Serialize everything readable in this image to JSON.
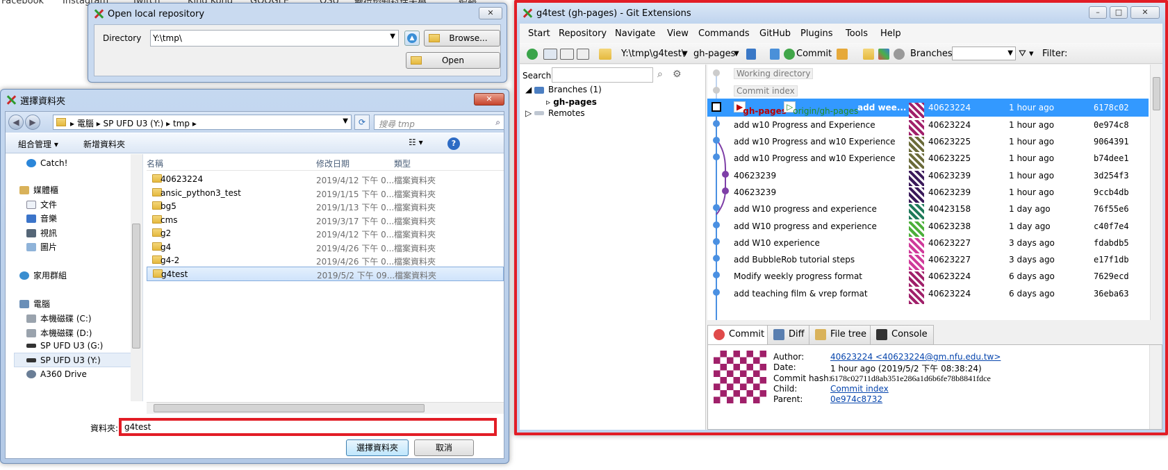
{
  "background": {
    "bookmarks": [
      "Facebook",
      "Instagram",
      "Twitch",
      "King Kong",
      "GOOGLE",
      "OSU",
      "數位控制科技大學",
      "編輯"
    ]
  },
  "open_repo": {
    "title": "Open local repository",
    "directory_label": "Directory",
    "directory_value": "Y:\\tmp\\",
    "browse_label": "Browse...",
    "open_label": "Open"
  },
  "folder_dialog": {
    "title": "選擇資料夾",
    "breadcrumb": [
      "電腦",
      "SP UFD U3 (Y:)",
      "tmp"
    ],
    "search_placeholder": "搜尋 tmp",
    "organize_label": "組合管理 ▾",
    "new_folder_label": "新增資料夾",
    "tree": [
      {
        "label": "Catch!",
        "icon": "catch-icon"
      },
      {
        "label": "媒體櫃",
        "icon": "library-icon"
      },
      {
        "label": "文件",
        "icon": "document-icon"
      },
      {
        "label": "音樂",
        "icon": "music-icon"
      },
      {
        "label": "視訊",
        "icon": "video-icon"
      },
      {
        "label": "圖片",
        "icon": "picture-icon"
      },
      {
        "label": "家用群組",
        "icon": "homegroup-icon"
      },
      {
        "label": "電腦",
        "icon": "computer-icon"
      },
      {
        "label": "本機磁碟 (C:)",
        "icon": "drive-icon"
      },
      {
        "label": "本機磁碟 (D:)",
        "icon": "drive-icon"
      },
      {
        "label": "SP UFD U3 (G:)",
        "icon": "usb-drive-icon"
      },
      {
        "label": "SP UFD U3 (Y:)",
        "icon": "usb-drive-icon"
      },
      {
        "label": "A360 Drive",
        "icon": "cloud-drive-icon"
      }
    ],
    "columns": [
      "名稱",
      "修改日期",
      "類型"
    ],
    "files": [
      {
        "name": "40623224",
        "date": "2019/4/12 下午 0...",
        "type": "檔案資料夾"
      },
      {
        "name": "ansic_python3_test",
        "date": "2019/1/15 下午 0...",
        "type": "檔案資料夾"
      },
      {
        "name": "bg5",
        "date": "2019/1/13 下午 0...",
        "type": "檔案資料夾"
      },
      {
        "name": "cms",
        "date": "2019/3/17 下午 0...",
        "type": "檔案資料夾"
      },
      {
        "name": "g2",
        "date": "2019/4/12 下午 0...",
        "type": "檔案資料夾"
      },
      {
        "name": "g4",
        "date": "2019/4/26 下午 0...",
        "type": "檔案資料夾"
      },
      {
        "name": "g4-2",
        "date": "2019/4/26 下午 0...",
        "type": "檔案資料夾"
      },
      {
        "name": "g4test",
        "date": "2019/5/2 下午 09...",
        "type": "檔案資料夾"
      }
    ],
    "folder_label": "資料夾:",
    "folder_value": "g4test",
    "select_label": "選擇資料夾",
    "cancel_label": "取消"
  },
  "git": {
    "title": "g4test (gh-pages) - Git Extensions",
    "menu": [
      "Start",
      "Repository",
      "Navigate",
      "View",
      "Commands",
      "GitHub",
      "Plugins",
      "Tools",
      "Help"
    ],
    "toolbar": {
      "path": "Y:\\tmp\\g4test\\",
      "branch": "gh-pages",
      "commit_label": "Commit",
      "branches_label": "Branches:",
      "filter_label": "Filter:"
    },
    "search_label": "Search:",
    "tree": {
      "branches": "Branches (1)",
      "current_branch": "gh-pages",
      "remotes": "Remotes"
    },
    "working_directory": "Working directory",
    "commit_index": "Commit index",
    "commits": [
      {
        "branch_tag": "gh-pages",
        "remote_tag": "origin/gh-pages",
        "message": "add wee...",
        "author": "40623224",
        "date": "1 hour ago",
        "hash": "6178c02",
        "selected": true
      },
      {
        "message": "add w10 Progress and Experience",
        "author": "40623224",
        "date": "1 hour ago",
        "hash": "0e974c8"
      },
      {
        "message": "add w10 Progress and w10 Experience",
        "author": "40623225",
        "date": "1 hour ago",
        "hash": "9064391"
      },
      {
        "message": "add w10 Progress and w10 Experience",
        "author": "40623225",
        "date": "1 hour ago",
        "hash": "b74dee1"
      },
      {
        "message": "40623239",
        "author": "40623239",
        "date": "1 hour ago",
        "hash": "3d254f3"
      },
      {
        "message": "40623239",
        "author": "40623239",
        "date": "1 hour ago",
        "hash": "9ccb4db"
      },
      {
        "message": "add W10 progress and experience",
        "author": "40423158",
        "date": "1 day ago",
        "hash": "76f55e6"
      },
      {
        "message": "add W10 progress and experience",
        "author": "40623238",
        "date": "1 day ago",
        "hash": "c40f7e4"
      },
      {
        "message": "add W10 experience",
        "author": "40623227",
        "date": "3 days ago",
        "hash": "fdabdb5"
      },
      {
        "message": "add BubbleRob tutorial steps",
        "author": "40623227",
        "date": "3 days ago",
        "hash": "e17f1db"
      },
      {
        "message": "Modify weekly progress format",
        "author": "40623224",
        "date": "6 days ago",
        "hash": "7629ecd"
      },
      {
        "message": "add teaching film & vrep format",
        "author": "40623224",
        "date": "6 days ago",
        "hash": "36eba63"
      }
    ],
    "tabs": [
      "Commit",
      "Diff",
      "File tree",
      "Console"
    ],
    "commit_info": {
      "author_label": "Author:",
      "author": "40623224 <40623224@gm.nfu.edu.tw>",
      "date_label": "Date:",
      "date": "1 hour ago (2019/5/2 下午 08:38:24)",
      "hash_label": "Commit hash:",
      "hash": "6178c02711d8ab351e286a1d6b6fe78b8841fdce",
      "child_label": "Child:",
      "child": "Commit index",
      "parent_label": "Parent:",
      "parent": "0e974c8732"
    }
  }
}
